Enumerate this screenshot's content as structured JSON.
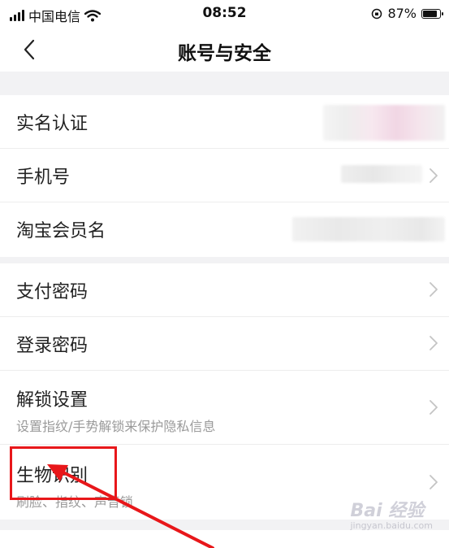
{
  "status_bar": {
    "carrier": "中国电信",
    "time": "08:52",
    "battery_percent": "87%",
    "battery_level": 0.87
  },
  "nav": {
    "title": "账号与安全"
  },
  "groups": [
    {
      "rows": [
        {
          "label": "实名认证",
          "has_chevron": false
        },
        {
          "label": "手机号",
          "has_chevron": true
        },
        {
          "label": "淘宝会员名",
          "has_chevron": false
        }
      ]
    },
    {
      "rows": [
        {
          "label": "支付密码",
          "has_chevron": true
        },
        {
          "label": "登录密码",
          "has_chevron": true
        },
        {
          "label": "解锁设置",
          "sub": "设置指纹/手势解锁来保护隐私信息",
          "has_chevron": true
        },
        {
          "label": "生物识别",
          "sub": "刷脸、指纹、声音锁",
          "has_chevron": true
        }
      ]
    }
  ],
  "annotation": {
    "highlight_color": "#e8171a",
    "target": "生物识别"
  },
  "watermark": {
    "text": "Bai 经验",
    "sub": "jingyan.baidu.com"
  },
  "colors": {
    "page_background": "#f2f2f4",
    "card_background": "#ffffff",
    "secondary_text": "#9a9a9a"
  }
}
